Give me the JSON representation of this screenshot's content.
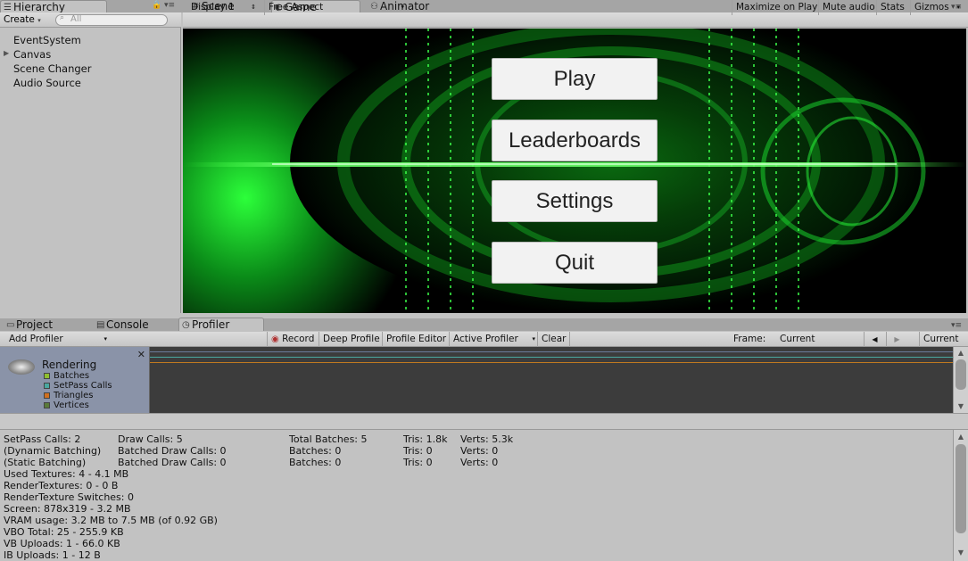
{
  "tabs_top": {
    "hierarchy": "Hierarchy",
    "scene": "Scene",
    "game": "Game",
    "animator": "Animator"
  },
  "hierarchy": {
    "create_label": "Create",
    "search_placeholder": "All",
    "items": [
      "EventSystem",
      "Canvas",
      "Scene Changer",
      "Audio Source"
    ]
  },
  "game_toolbar": {
    "display": "Display 1",
    "aspect": "Free Aspect",
    "maximize": "Maximize on Play",
    "mute": "Mute audio",
    "stats": "Stats",
    "gizmos": "Gizmos"
  },
  "game_menu": {
    "buttons": [
      "Play",
      "Leaderboards",
      "Settings",
      "Quit"
    ]
  },
  "tabs_bottom": {
    "project": "Project",
    "console": "Console",
    "profiler": "Profiler"
  },
  "profiler_toolbar": {
    "add_profiler": "Add Profiler",
    "record": "Record",
    "deep_profile": "Deep Profile",
    "profile_editor": "Profile Editor",
    "active_profiler": "Active Profiler",
    "clear": "Clear",
    "frame_label": "Frame:",
    "frame_value": "Current",
    "current_button": "Current"
  },
  "profiler_module": {
    "title": "Rendering",
    "legend": [
      {
        "label": "Batches",
        "color": "#8fbf2f"
      },
      {
        "label": "SetPass Calls",
        "color": "#4aa8a0"
      },
      {
        "label": "Triangles",
        "color": "#d07020"
      },
      {
        "label": "Vertices",
        "color": "#5a7a3a"
      }
    ]
  },
  "stats": {
    "col1": [
      "SetPass Calls: 2",
      "(Dynamic Batching)",
      "(Static Batching)",
      "Used Textures: 4 - 4.1 MB",
      "RenderTextures: 0 - 0 B",
      "RenderTexture Switches: 0",
      "Screen: 878x319 - 3.2 MB",
      "VRAM usage: 3.2 MB to 7.5 MB (of 0.92 GB)",
      "VBO Total: 25 - 255.9 KB",
      "VB Uploads: 1 - 66.0 KB",
      "IB Uploads: 1 - 12 B"
    ],
    "col2": [
      "Draw Calls: 5",
      "Batched Draw Calls: 0",
      "Batched Draw Calls: 0"
    ],
    "col3": [
      "Total Batches: 5",
      "Batches: 0",
      "Batches: 0"
    ],
    "col4": [
      "Tris: 1.8k",
      "Tris: 0",
      "Tris: 0"
    ],
    "col5": [
      "Verts: 5.3k",
      "Verts: 0",
      "Verts: 0"
    ]
  }
}
